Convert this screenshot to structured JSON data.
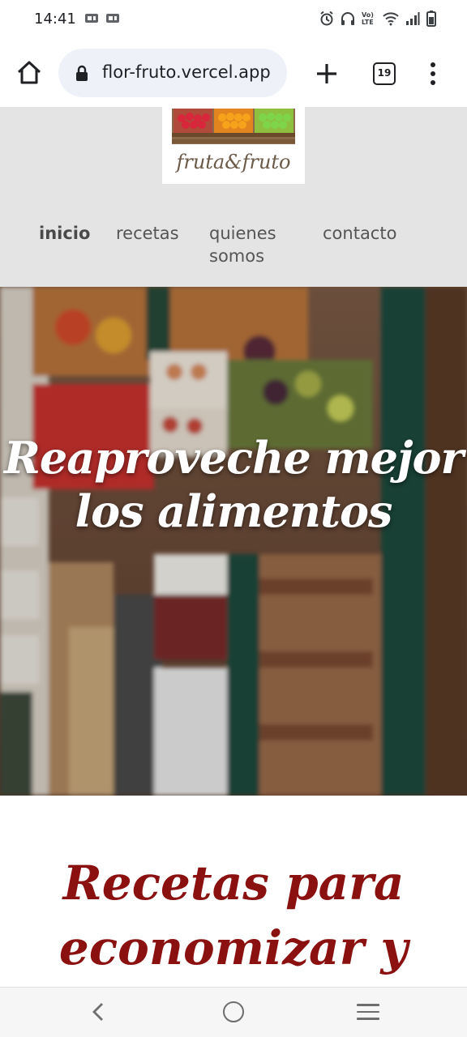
{
  "status_bar": {
    "time": "14:41",
    "icons_left": [
      "sim-card-icon",
      "sim-card-icon"
    ],
    "icons_right": [
      "alarm-icon",
      "headphones-icon",
      "volte-icon",
      "wifi-icon",
      "signal-icon",
      "battery-icon"
    ],
    "volte_text": "Vo) LTE"
  },
  "browser": {
    "url": "flor-fruto.vercel.app",
    "tab_count": "19",
    "icons": [
      "home-icon",
      "lock-icon",
      "plus-icon",
      "tabs-icon",
      "more-vertical-icon"
    ]
  },
  "header": {
    "logo_text": "fruta&fruto",
    "nav": [
      {
        "label": "inicio",
        "active": true
      },
      {
        "label": "recetas",
        "active": false
      },
      {
        "label": "quienes somos",
        "active": false
      },
      {
        "label": "contacto",
        "active": false
      }
    ]
  },
  "hero": {
    "title": "Reaproveche mejor los alimentos"
  },
  "recipes": {
    "title": "Recetas para economizar y"
  },
  "bottom_nav": {
    "icons": [
      "back-icon",
      "home-circle-icon",
      "recents-icon"
    ]
  },
  "colors": {
    "header_bg": "#e4e4e4",
    "section_title": "#8b1010",
    "url_pill": "#eef2f8"
  }
}
